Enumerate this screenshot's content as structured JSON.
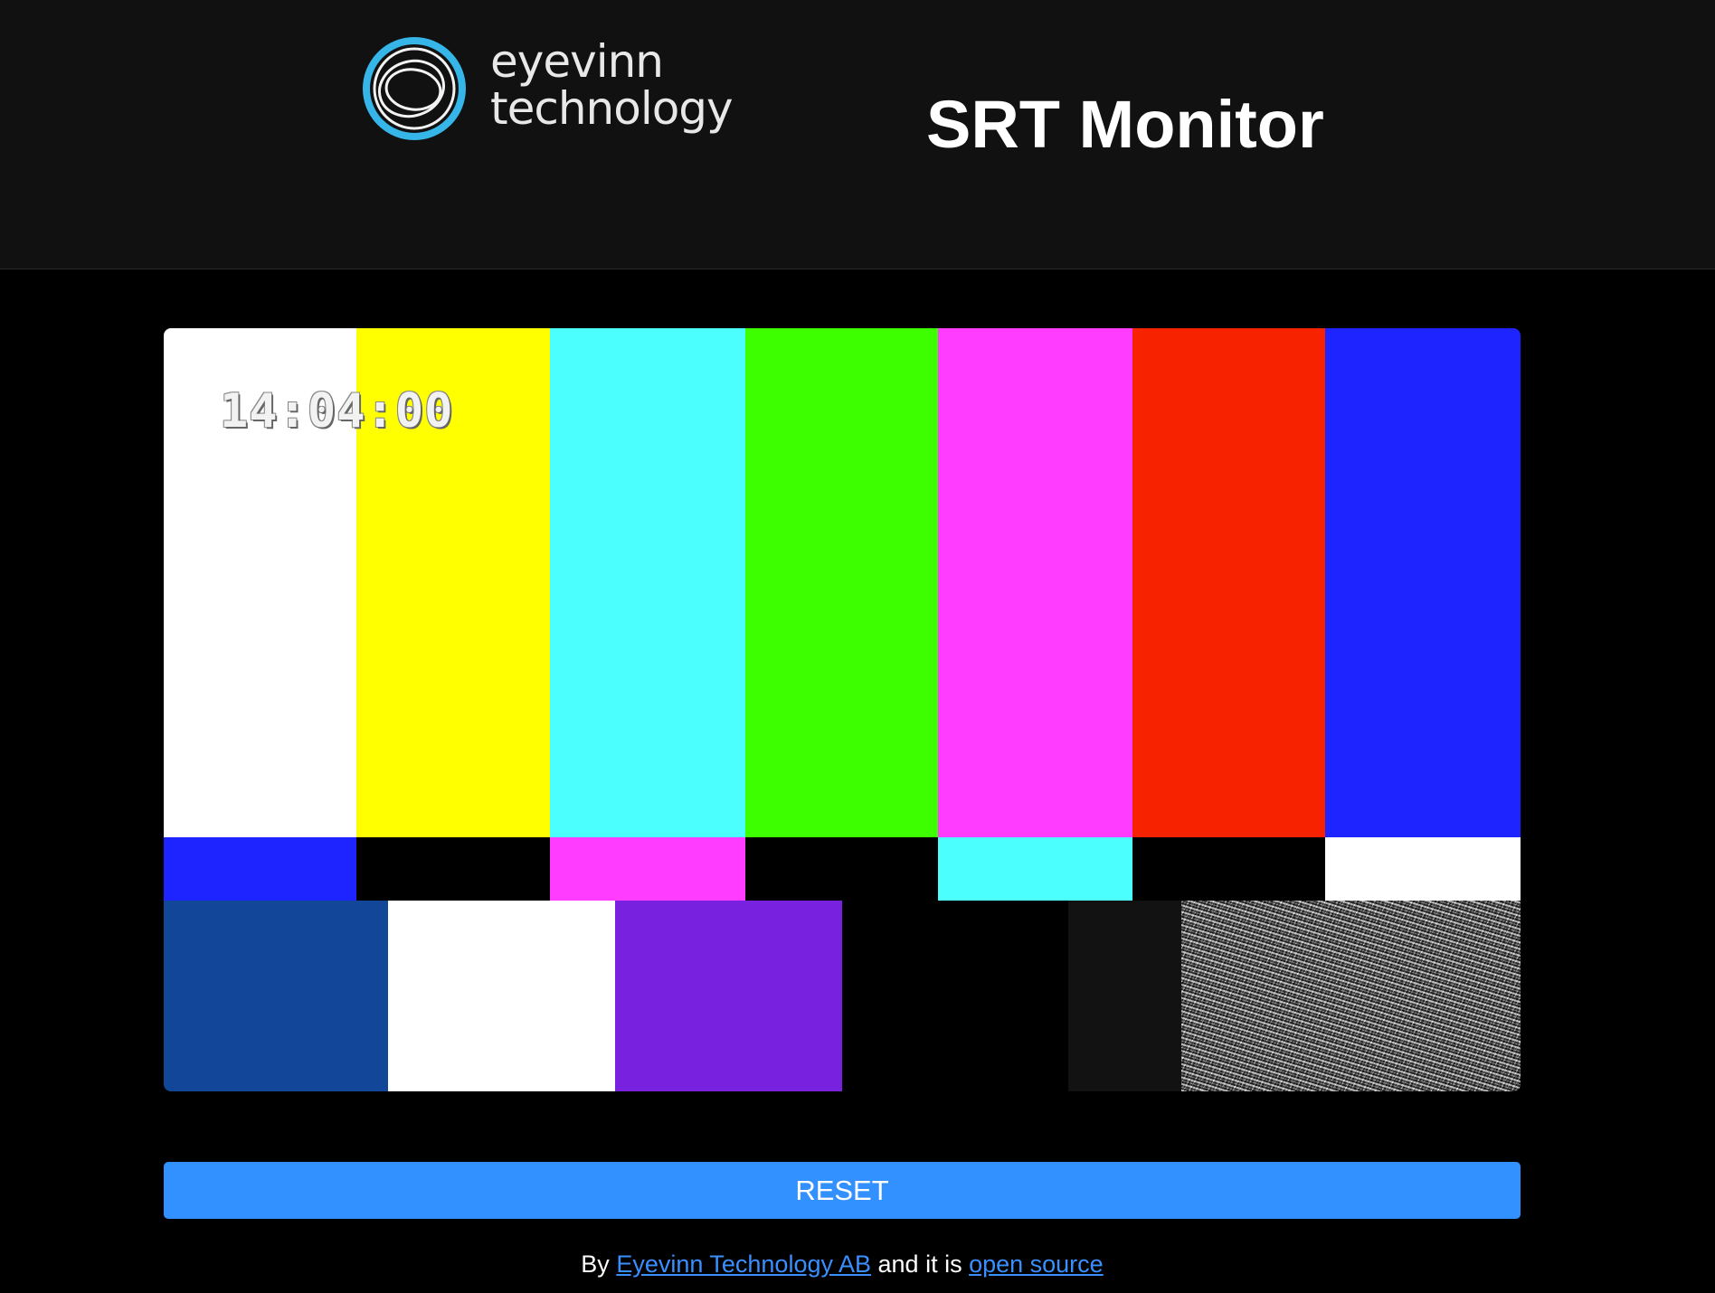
{
  "header": {
    "logo": {
      "line1": "eyevinn",
      "line2": "technology"
    },
    "title": "SRT Monitor"
  },
  "player": {
    "timecode": "14:04:00",
    "test_pattern": {
      "top_bars": [
        "#ffffff",
        "#ffff00",
        "#4bffff",
        "#3dff00",
        "#ff3cff",
        "#f72300",
        "#1d24ff"
      ],
      "middle_bars": [
        "#1d24ff",
        "#000000",
        "#ff3cff",
        "#000000",
        "#4bffff",
        "#000000",
        "#ffffff"
      ],
      "bottom_bars": [
        "#124699",
        "#ffffff",
        "#7822e0",
        "#000000",
        "#000000",
        "#121212",
        "noise"
      ]
    }
  },
  "controls": {
    "reset_label": "RESET",
    "reset_color": "#3390ff"
  },
  "footer": {
    "prefix": "By ",
    "company_link": "Eyevinn Technology AB",
    "middle": " and it is ",
    "source_link": "open source"
  }
}
